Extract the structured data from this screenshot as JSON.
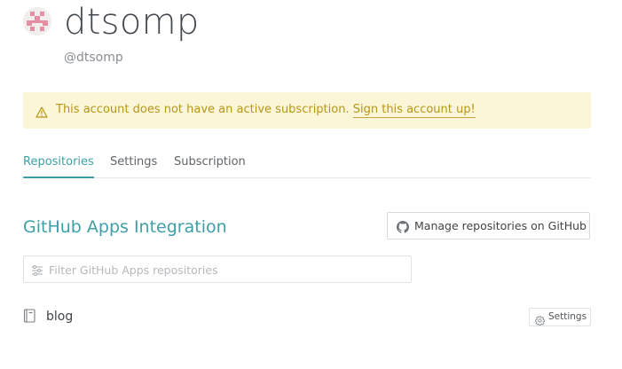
{
  "profile": {
    "name": "dtsomp",
    "handle": "@dtsomp"
  },
  "banner": {
    "message": "This account does not have an active subscription.",
    "link_label": "Sign this account up!",
    "icon": "warning-triangle-icon",
    "color": "#b99516",
    "background": "#fbf6d7"
  },
  "tabs": [
    {
      "label": "Repositories",
      "active": true
    },
    {
      "label": "Settings",
      "active": false
    },
    {
      "label": "Subscription",
      "active": false
    }
  ],
  "section": {
    "title": "GitHub Apps Integration",
    "manage_button_label": "Manage repositories on GitHub"
  },
  "filter": {
    "placeholder": "Filter GitHub Apps repositories",
    "value": ""
  },
  "repositories": [
    {
      "name": "blog",
      "settings_label": "Settings"
    }
  ],
  "colors": {
    "accent": "#3ea0a6",
    "text": "#404448"
  }
}
